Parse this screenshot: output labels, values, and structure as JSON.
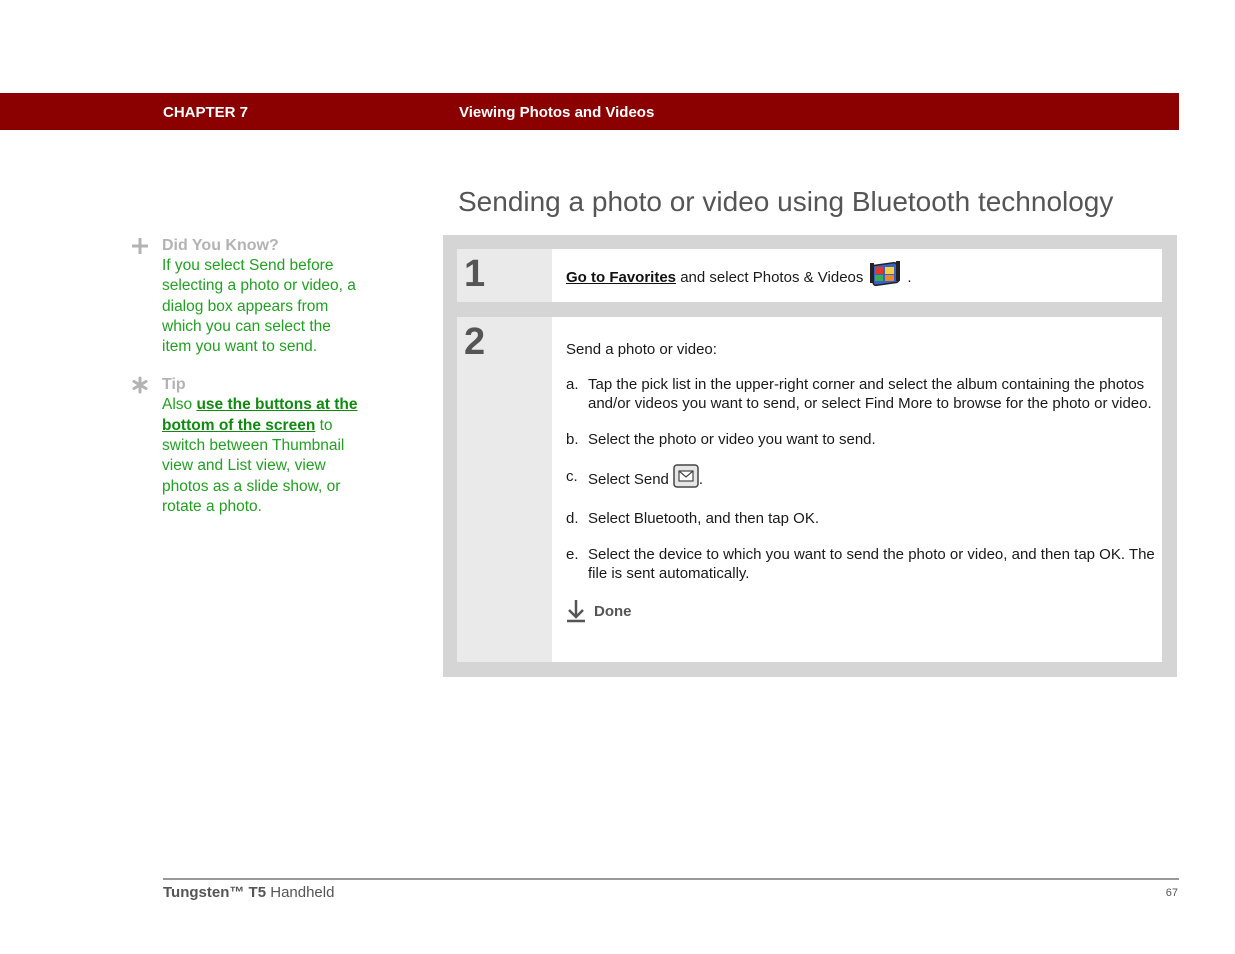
{
  "header": {
    "chapter": "CHAPTER 7",
    "chapter_title": "Viewing Photos and Videos",
    "band_color": "#8b0000"
  },
  "page_title": "Sending a photo or video using Bluetooth technology",
  "sidebar": {
    "did_you_know": {
      "icon": "plus-icon",
      "heading": "Did You Know?",
      "text": "If you select Send before selecting a photo or video, a dialog box appears from which you can select the item you want to send."
    },
    "tip": {
      "icon": "asterisk-icon",
      "heading": "Tip",
      "text_before": "Also ",
      "link": "use the buttons at the bottom of the screen",
      "text_after": " to switch between Thumbnail view and List view, view photos as a slide show, or rotate a photo."
    }
  },
  "steps": [
    {
      "number": "1",
      "link": "Go to Favorites",
      "text": " and select Photos & Videos",
      "icon": "photos-videos-icon",
      "end": "."
    },
    {
      "number": "2",
      "intro": "Send a photo or video:",
      "substeps": [
        {
          "letter": "a.",
          "text": "Tap the pick list in the upper-right corner and select the album containing the photos and/or videos you want to send, or select Find More to browse for the photo or video."
        },
        {
          "letter": "b.",
          "text": "Select the photo or video you want to send."
        },
        {
          "letter": "c.",
          "text": "Select Send",
          "icon": "send-icon",
          "end": "."
        },
        {
          "letter": "d.",
          "text": "Select Bluetooth, and then tap OK."
        },
        {
          "letter": "e.",
          "text": "Select the device to which you want to send the photo or video, and then tap OK. The file is sent automatically."
        }
      ],
      "done_label": "Done",
      "done_icon": "done-arrow-icon"
    }
  ],
  "footer": {
    "brand": "Tungsten™ T5",
    "product": " Handheld",
    "page_number": "67"
  }
}
